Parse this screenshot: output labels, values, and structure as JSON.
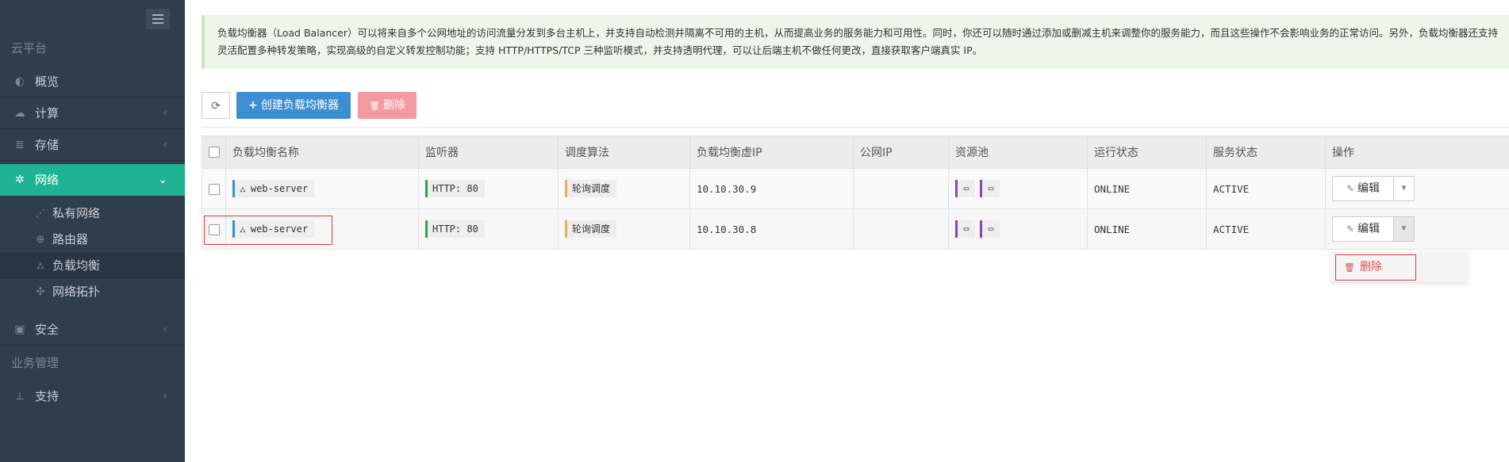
{
  "sidebar": {
    "section_cloud": "云平台",
    "section_biz": "业务管理",
    "items": [
      {
        "label": "概览",
        "icon": "dashboard-icon"
      },
      {
        "label": "计算",
        "icon": "cloud-icon"
      },
      {
        "label": "存储",
        "icon": "database-icon"
      },
      {
        "label": "网络",
        "icon": "network-icon",
        "active": true
      },
      {
        "label": "安全",
        "icon": "shield-icon"
      },
      {
        "label": "支持",
        "icon": "pin-icon"
      }
    ],
    "subitems": [
      {
        "label": "私有网络",
        "icon": "rss-icon"
      },
      {
        "label": "路由器",
        "icon": "globe-icon"
      },
      {
        "label": "负载均衡",
        "icon": "sitemap-icon",
        "selected": true
      },
      {
        "label": "网络拓扑",
        "icon": "topology-icon"
      }
    ]
  },
  "alert": {
    "text": "负载均衡器（Load Balancer）可以将来自多个公网地址的访问流量分发到多台主机上，并支持自动检测并隔离不可用的主机，从而提高业务的服务能力和可用性。同时，你还可以随时通过添加或删减主机来调整你的服务能力，而且这些操作不会影响业务的正常访问。另外，负载均衡器还支持灵活配置多种转发策略，实现高级的自定义转发控制功能；支持 HTTP/HTTPS/TCP 三种监听模式，并支持透明代理，可以让后端主机不做任何更改，直接获取客户端真实 IP。"
  },
  "toolbar": {
    "create_label": "创建负载均衡器",
    "delete_label": "删除"
  },
  "table": {
    "headers": [
      "负载均衡名称",
      "监听器",
      "调度算法",
      "负载均衡虚IP",
      "公网IP",
      "资源池",
      "运行状态",
      "服务状态",
      "操作"
    ],
    "rows": [
      {
        "name": "web-server",
        "listener": "HTTP: 80",
        "algorithm": "轮询调度",
        "vip": "10.10.30.9",
        "public_ip": "",
        "run_state": "ONLINE",
        "service_state": "ACTIVE",
        "edit_label": "编辑"
      },
      {
        "name": "web-server",
        "listener": "HTTP: 80",
        "algorithm": "轮询调度",
        "vip": "10.10.30.8",
        "public_ip": "",
        "run_state": "ONLINE",
        "service_state": "ACTIVE",
        "edit_label": "编辑"
      }
    ]
  },
  "dropdown": {
    "delete_label": "删除"
  },
  "colors": {
    "sidebar_bg": "#2f3d4c",
    "active": "#1fb394",
    "primary": "#3d8fd1",
    "danger": "#f39aa0",
    "highlight": "#e23b3b"
  }
}
